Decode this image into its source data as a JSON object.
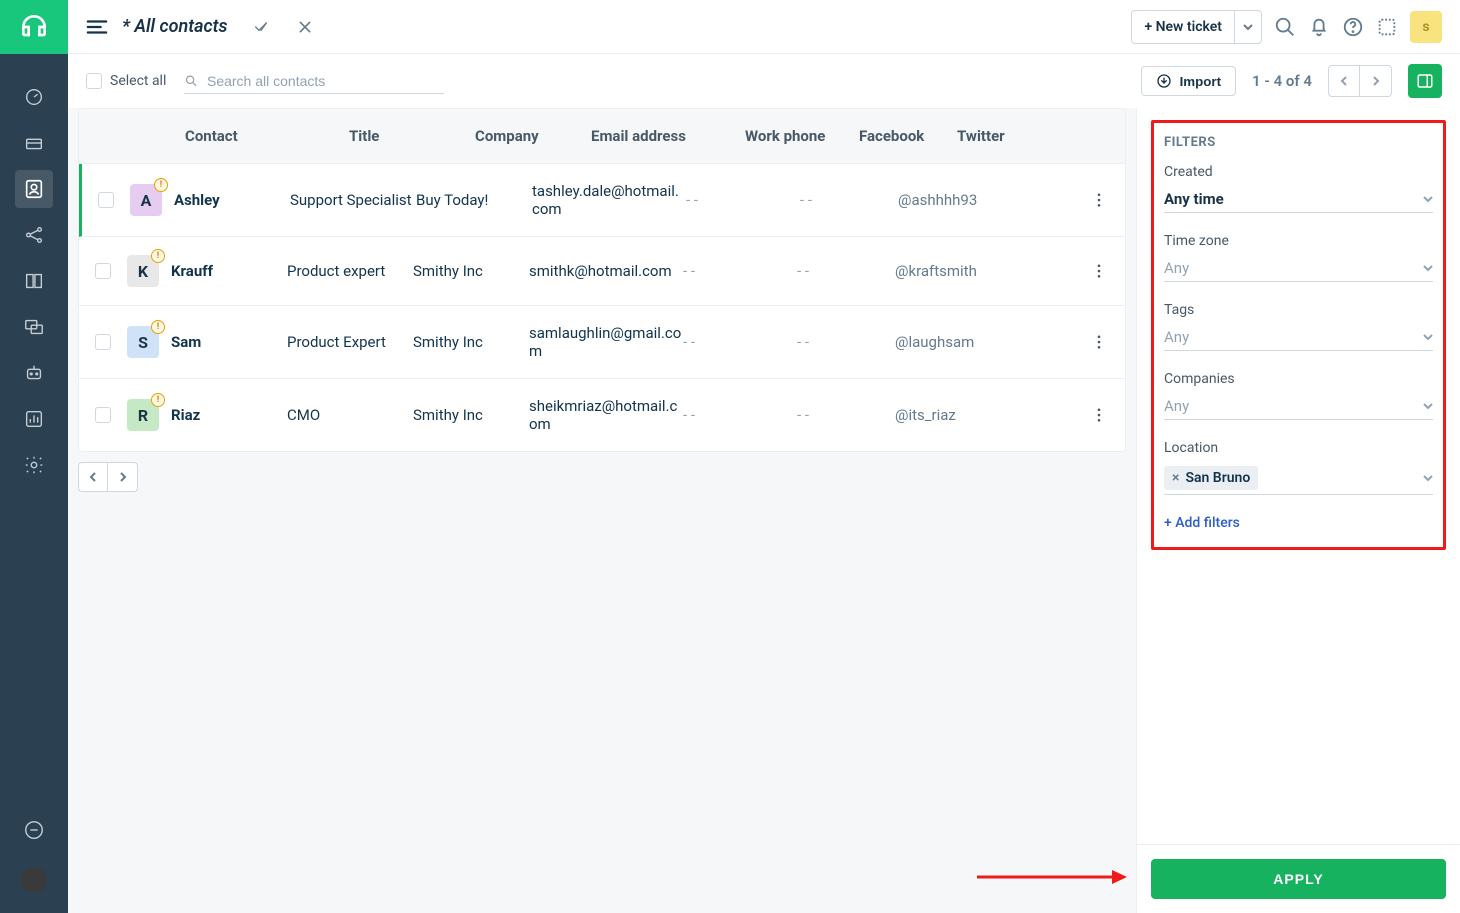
{
  "header": {
    "page_title_prefix": "* ",
    "page_title": "All contacts",
    "new_ticket_label": "+ New ticket",
    "user_initial": "s"
  },
  "toolbar": {
    "select_all": "Select all",
    "search_placeholder": "Search all contacts",
    "import_label": "Import",
    "page_count": "1 - 4 of 4"
  },
  "columns": {
    "contact": "Contact",
    "title": "Title",
    "company": "Company",
    "email": "Email address",
    "work_phone": "Work phone",
    "facebook": "Facebook",
    "twitter": "Twitter"
  },
  "rows": [
    {
      "initial": "A",
      "avatar_bg": "#e6ccf1",
      "name": "Ashley",
      "title": "Support Specialist",
      "company": "Buy Today!",
      "email": "tashley.dale@hotmail.com",
      "work": "- -",
      "fb": "- -",
      "twitter": "@ashhhh93"
    },
    {
      "initial": "K",
      "avatar_bg": "#e8e8e8",
      "name": "Krauff",
      "title": "Product expert",
      "company": "Smithy Inc",
      "email": "smithk@hotmail.com",
      "work": "- -",
      "fb": "- -",
      "twitter": "@kraftsmith"
    },
    {
      "initial": "S",
      "avatar_bg": "#cfe2f7",
      "name": "Sam",
      "title": "Product Expert",
      "company": "Smithy Inc",
      "email": "samlaughlin@gmail.com",
      "work": "- -",
      "fb": "- -",
      "twitter": "@laughsam"
    },
    {
      "initial": "R",
      "avatar_bg": "#c5e8c5",
      "name": "Riaz",
      "title": "CMO",
      "company": "Smithy Inc",
      "email": "sheikmriaz@hotmail.com",
      "work": "- -",
      "fb": "- -",
      "twitter": "@its_riaz"
    }
  ],
  "filters": {
    "title": "FILTERS",
    "created_label": "Created",
    "created_value": "Any time",
    "timezone_label": "Time zone",
    "timezone_value": "Any",
    "tags_label": "Tags",
    "tags_value": "Any",
    "companies_label": "Companies",
    "companies_value": "Any",
    "location_label": "Location",
    "location_chip": "San Bruno",
    "add_filters": "+ Add filters",
    "apply": "APPLY"
  }
}
